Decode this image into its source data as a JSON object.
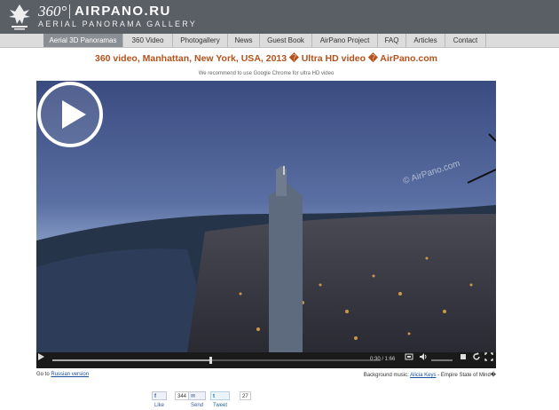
{
  "header": {
    "logo_360": "360°",
    "logo_name": "AIRPANO.RU",
    "logo_subtitle": "AERIAL PANORAMA GALLERY"
  },
  "nav": [
    {
      "label": "Aerial 3D Panoramas",
      "active": true
    },
    {
      "label": "360 Video",
      "active": false
    },
    {
      "label": "Photogallery",
      "active": false
    },
    {
      "label": "News",
      "active": false
    },
    {
      "label": "Guest Book",
      "active": false
    },
    {
      "label": "AirPano Project",
      "active": false
    },
    {
      "label": "FAQ",
      "active": false
    },
    {
      "label": "Articles",
      "active": false
    },
    {
      "label": "Contact",
      "active": false
    }
  ],
  "page": {
    "title": "360 video, Manhattan, New York, USA, 2013 � Ultra HD video � AirPano.com",
    "hint": "We recommend to use Google Chrome for ultra HD video"
  },
  "video": {
    "watermark": "© AirPano.com",
    "time": "0:30 / 1:66",
    "progress": 0.48
  },
  "footer": {
    "goto_prefix": "Go to",
    "goto_link": "Russian version",
    "music_prefix": "Background music:",
    "music_artist": "Alicia Keys",
    "music_suffix": " - Empire State of Mind�"
  },
  "social": {
    "like_label": "Like",
    "like_count": "344",
    "send_label": "Send",
    "tweet_label": "Tweet",
    "tweet_count": "27"
  },
  "colors": {
    "header_bg": "#5a5f66",
    "title_color": "#b5511a",
    "link_color": "#1a4d9c"
  }
}
